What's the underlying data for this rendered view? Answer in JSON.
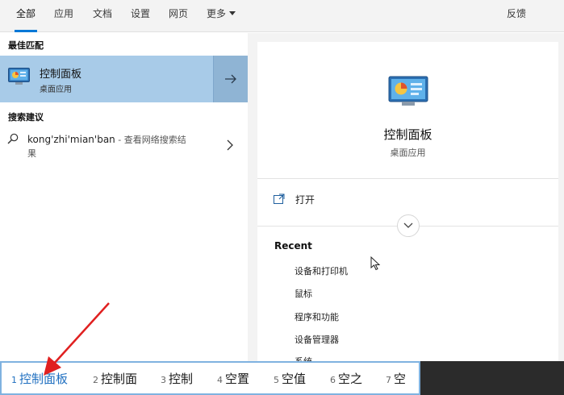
{
  "tabs": [
    "全部",
    "应用",
    "文档",
    "设置",
    "网页",
    "更多"
  ],
  "feedback": "反馈",
  "left": {
    "best_match_heading": "最佳匹配",
    "best_match": {
      "title": "控制面板",
      "subtitle": "桌面应用"
    },
    "search_suggest_heading": "搜索建议",
    "suggestion": {
      "query": "kong'zhi'mian'ban",
      "suffix": " - 查看网络搜索结",
      "wrap": "果"
    }
  },
  "detail": {
    "title": "控制面板",
    "subtitle": "桌面应用",
    "open_label": "打开",
    "recent_heading": "Recent",
    "recent_items": [
      "设备和打印机",
      "鼠标",
      "程序和功能",
      "设备管理器",
      "系统"
    ]
  },
  "ime": {
    "candidates": [
      {
        "num": "1",
        "word": "控制面板"
      },
      {
        "num": "2",
        "word": "控制面"
      },
      {
        "num": "3",
        "word": "控制"
      },
      {
        "num": "4",
        "word": "空置"
      },
      {
        "num": "5",
        "word": "空值"
      },
      {
        "num": "6",
        "word": "空之"
      },
      {
        "num": "7",
        "word": "空"
      }
    ],
    "selected_index": 0
  },
  "colors": {
    "accent": "#0078d7",
    "best_match_bg": "#a8cbe8",
    "annotation_red": "#e02020"
  },
  "icons": [
    "control-panel-icon",
    "arrow-right-icon",
    "search-icon",
    "chevron-right-icon",
    "open-window-icon",
    "chevron-down-icon",
    "mouse-cursor-icon"
  ]
}
